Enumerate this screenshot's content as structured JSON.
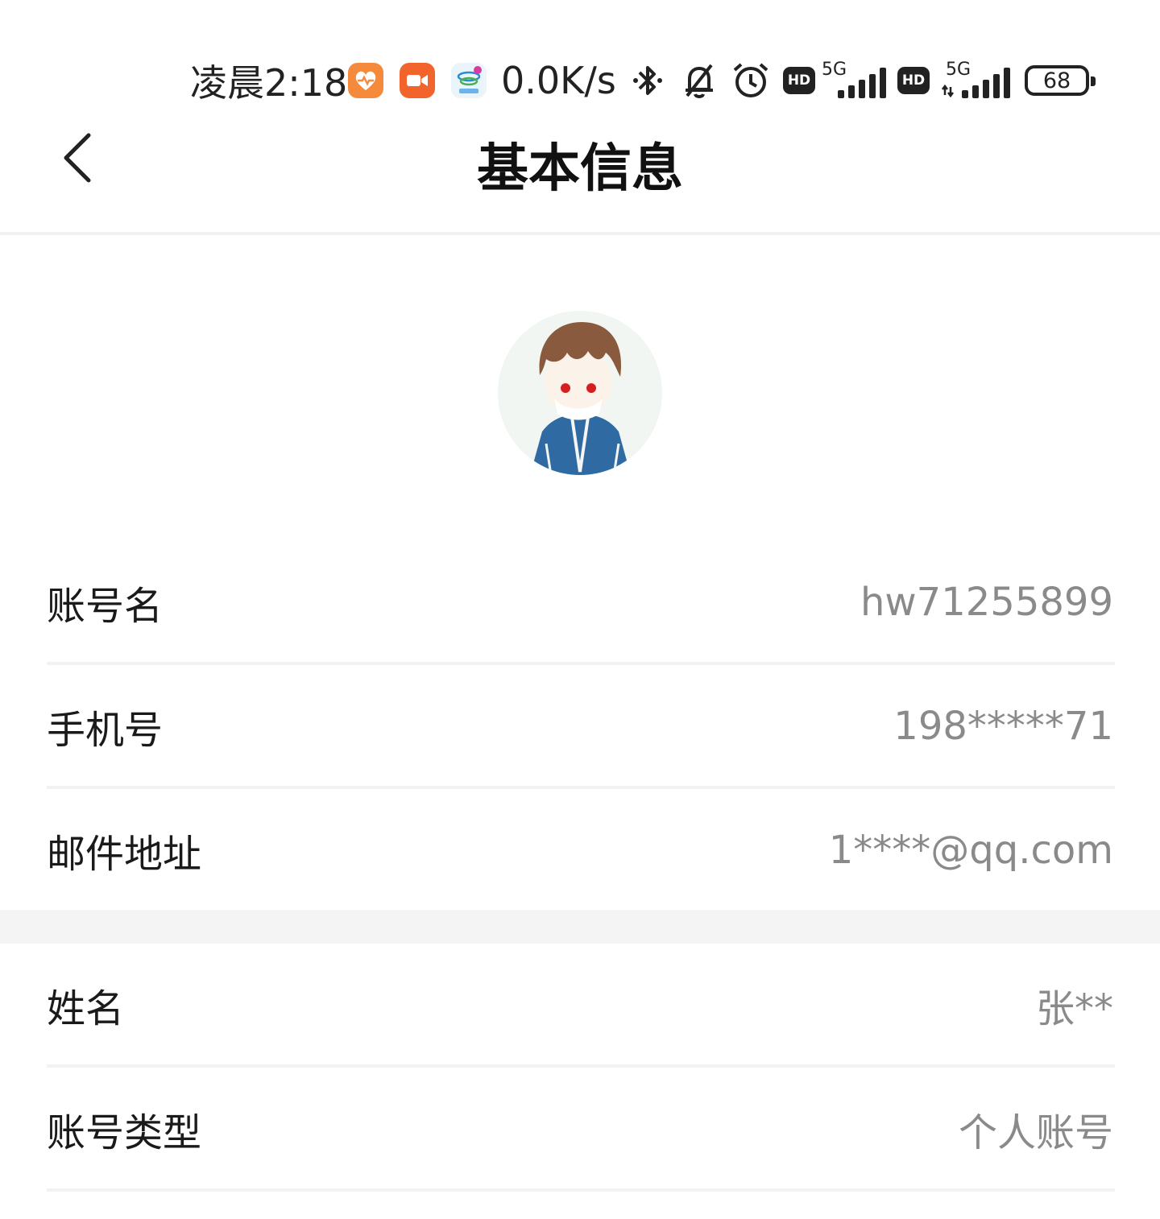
{
  "status_bar": {
    "time": "凌晨2:18",
    "net_speed": "0.0K/s",
    "network_1": "5G",
    "network_2": "5G",
    "hd_1": "HD",
    "hd_2": "HD",
    "battery": "68",
    "icons": [
      "health-app-icon",
      "video-app-icon",
      "carrier-app-icon",
      "bluetooth-icon",
      "mute-bell-icon",
      "alarm-icon",
      "signal-icon",
      "signal-icon"
    ]
  },
  "header": {
    "title": "基本信息",
    "back_icon": "chevron-left-icon"
  },
  "profile": {
    "avatar_icon": "avatar-illustration"
  },
  "rows": [
    {
      "label": "账号名",
      "value": "hw71255899"
    },
    {
      "label": "手机号",
      "value": "198*****71"
    },
    {
      "label": "邮件地址",
      "value": "1****@qq.com"
    },
    {
      "label": "姓名",
      "value": "张**"
    },
    {
      "label": "账号类型",
      "value": "个人账号"
    }
  ],
  "colors": {
    "background": "#ffffff",
    "label_text": "#1a1a1a",
    "value_text": "#8a8a8a",
    "divider": "#f2f2f2",
    "section_gap": "#f4f4f4"
  }
}
